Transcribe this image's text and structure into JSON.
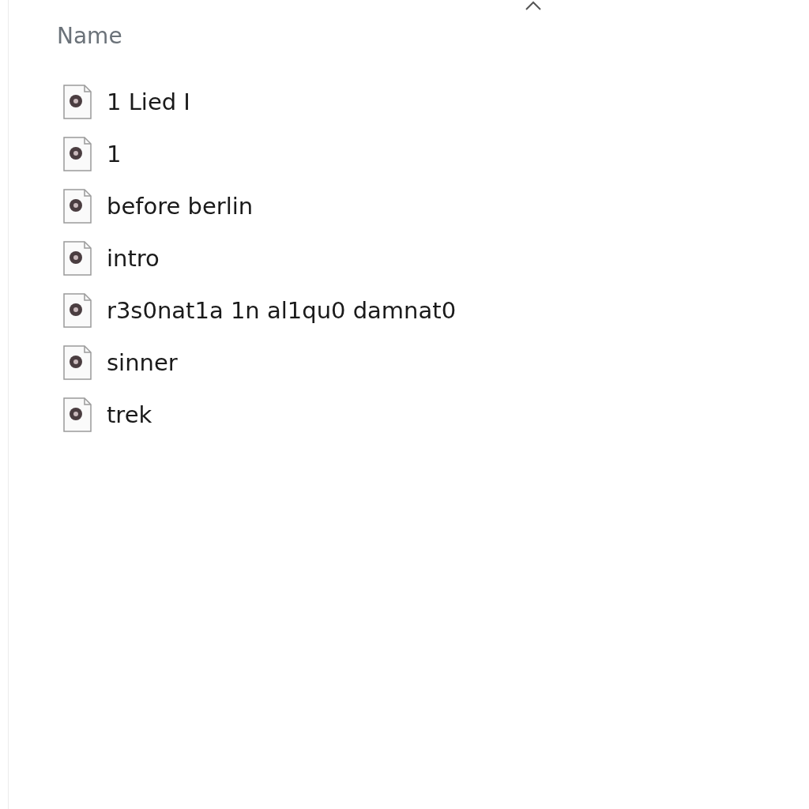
{
  "column_header": {
    "label": "Name"
  },
  "files": [
    {
      "name": "1 Lied I"
    },
    {
      "name": "1"
    },
    {
      "name": "before berlin"
    },
    {
      "name": "intro"
    },
    {
      "name": "r3s0nat1a 1n al1qu0 damnat0"
    },
    {
      "name": "sinner"
    },
    {
      "name": "trek"
    }
  ]
}
